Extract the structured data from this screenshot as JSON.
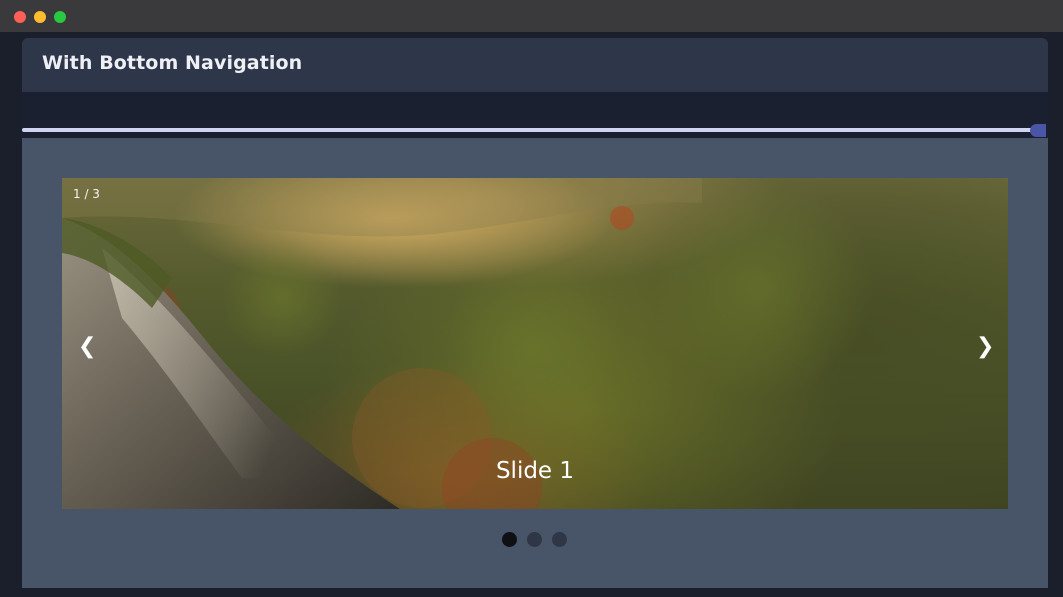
{
  "window": {
    "controls": [
      "close",
      "minimize",
      "maximize"
    ]
  },
  "card": {
    "title": "With Bottom Navigation"
  },
  "progress": {
    "value_percent": 100,
    "track_color": "#cfd4ef",
    "thumb_color": "#4a55a8"
  },
  "carousel": {
    "counter": "1 / 3",
    "prev_icon": "❮",
    "next_icon": "❯",
    "current_slide": 1,
    "total_slides": 3,
    "slides": [
      {
        "caption": "Slide 1"
      }
    ],
    "dot_active_color": "#0e1014",
    "dot_inactive_color": "#2f3746"
  }
}
